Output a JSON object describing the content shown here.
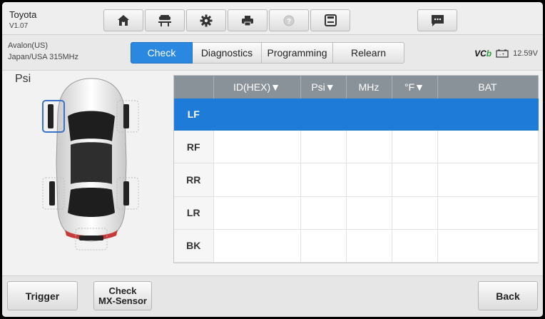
{
  "app": {
    "name": "Toyota",
    "version": "V1.07"
  },
  "toolbar": {
    "icons": [
      "home-icon",
      "vehicle-lift-icon",
      "gear-icon",
      "printer-icon",
      "help-icon",
      "save-icon",
      "chat-icon"
    ]
  },
  "vehicle": {
    "model": "Avalon(US)",
    "frequency": "Japan/USA 315MHz"
  },
  "tabs": [
    {
      "label": "Check",
      "active": true
    },
    {
      "label": "Diagnostics",
      "active": false
    },
    {
      "label": "Programming",
      "active": false
    },
    {
      "label": "Relearn",
      "active": false
    }
  ],
  "status": {
    "vci_prefix": "VC",
    "vci_suffix": "b",
    "voltage": "12.59V"
  },
  "main": {
    "unit": "Psi"
  },
  "table": {
    "headers": [
      "",
      "ID(HEX)▼",
      "Psi▼",
      "MHz",
      "°F▼",
      "BAT"
    ],
    "rows": [
      {
        "pos": "LF",
        "selected": true
      },
      {
        "pos": "RF",
        "selected": false
      },
      {
        "pos": "RR",
        "selected": false
      },
      {
        "pos": "LR",
        "selected": false
      },
      {
        "pos": "BK",
        "selected": false
      }
    ]
  },
  "bottom": {
    "trigger": "Trigger",
    "check_line1": "Check",
    "check_line2": "MX-Sensor",
    "back": "Back"
  },
  "colors": {
    "accent": "#2a88e0",
    "selected_row": "#1f7bd8",
    "header": "#8a9299"
  }
}
